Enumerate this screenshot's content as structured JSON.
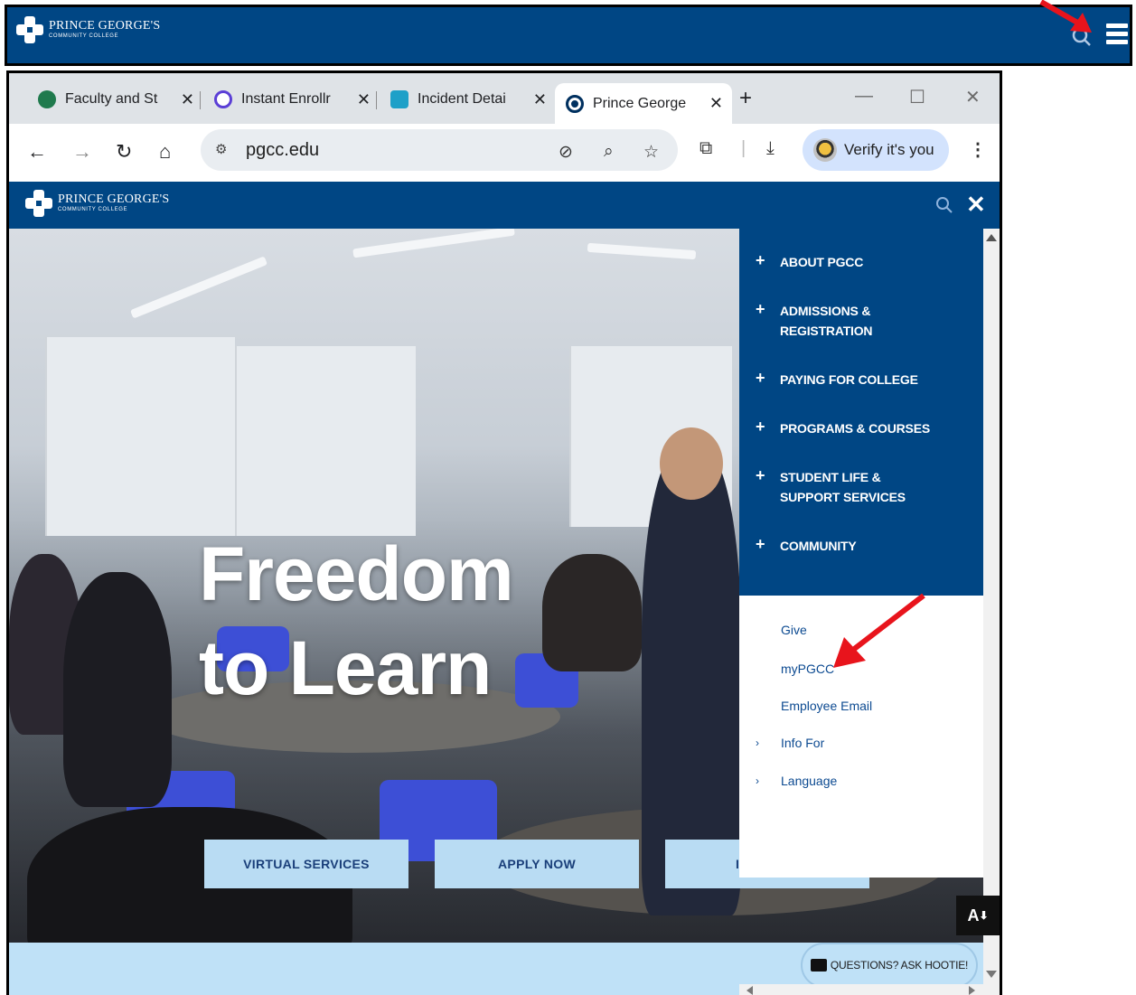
{
  "top_header": {
    "logo_name": "PRINCE GEORGE'S",
    "logo_sub": "COMMUNITY COLLEGE"
  },
  "browser": {
    "tabs": [
      {
        "label": "Faculty and St",
        "icon_color": "#1f7a4d",
        "active": false
      },
      {
        "label": "Instant Enrollr",
        "icon_color": "#5b3fd6",
        "active": false
      },
      {
        "label": "Incident Detai",
        "icon_color": "#1ea0c8",
        "active": false
      },
      {
        "label": "Prince George",
        "icon_color": "#00305f",
        "active": true
      }
    ],
    "close_glyph": "✕",
    "new_tab_glyph": "+",
    "url": "pgcc.edu",
    "verify_label": "Verify it's you"
  },
  "site": {
    "logo_name": "PRINCE GEORGE'S",
    "logo_sub": "COMMUNITY COLLEGE",
    "close_glyph": "✕",
    "hero": {
      "title_line1": "Freedom",
      "title_line2": "to Learn",
      "buttons": [
        "VIRTUAL SERVICES",
        "APPLY NOW",
        "I"
      ]
    },
    "menu": {
      "main_items": [
        "ABOUT PGCC",
        "ADMISSIONS & REGISTRATION",
        "PAYING FOR COLLEGE",
        "PROGRAMS & COURSES",
        "STUDENT LIFE & SUPPORT SERVICES",
        "COMMUNITY"
      ],
      "plus_glyph": "+",
      "utility_links": [
        "Give",
        "myPGCC",
        "Employee Email",
        "Info For",
        "Language"
      ],
      "caret_glyph": "›"
    },
    "accessibility_label": "A",
    "hootie_label": "QUESTIONS? ASK HOOTIE!"
  },
  "colors": {
    "brand_blue": "#004684",
    "light_blue": "#bfe1f7",
    "annotation_red": "#e8141c"
  }
}
